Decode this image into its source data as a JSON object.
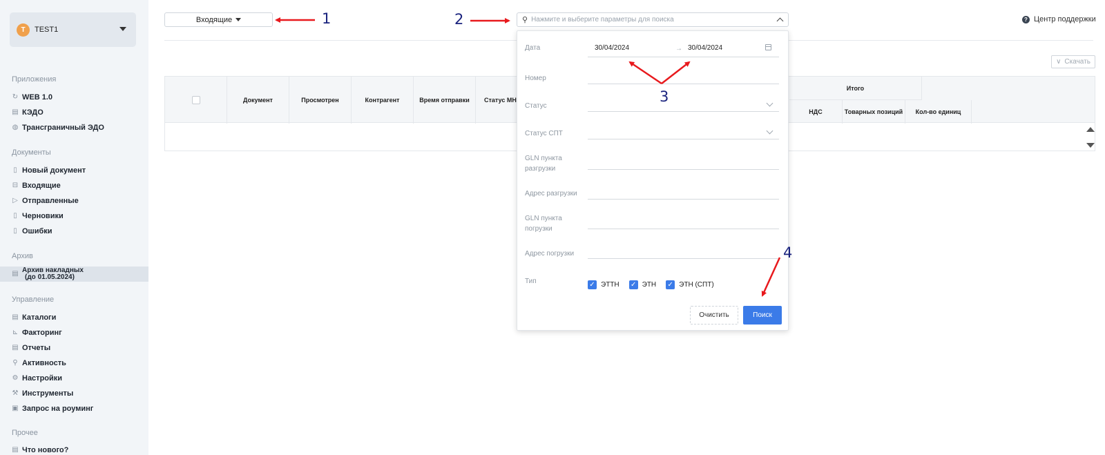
{
  "user": {
    "initial": "T",
    "name": "TEST1"
  },
  "sidebar": {
    "sections": {
      "apps": "Приложения",
      "documents": "Документы",
      "archive": "Архив",
      "management": "Управление",
      "other": "Прочее"
    },
    "apps": [
      {
        "label": "WEB 1.0",
        "icon": "refresh-icon"
      },
      {
        "label": "КЭДО",
        "icon": "document-icon"
      },
      {
        "label": "Трансграничный ЭДО",
        "icon": "globe-icon"
      }
    ],
    "documents": [
      {
        "label": "Новый документ",
        "icon": "new-document-icon"
      },
      {
        "label": "Входящие",
        "icon": "inbox-icon"
      },
      {
        "label": "Отправленные",
        "icon": "send-icon"
      },
      {
        "label": "Черновики",
        "icon": "draft-icon"
      },
      {
        "label": "Ошибки",
        "icon": "error-document-icon"
      }
    ],
    "archive": {
      "line1": "Архив накладных",
      "line2": "(до 01.05.2024)"
    },
    "management": [
      {
        "label": "Каталоги",
        "icon": "catalog-icon"
      },
      {
        "label": "Факторинг",
        "icon": "chart-icon"
      },
      {
        "label": "Отчеты",
        "icon": "report-icon"
      },
      {
        "label": "Активность",
        "icon": "search-icon"
      },
      {
        "label": "Настройки",
        "icon": "gear-icon"
      },
      {
        "label": "Инструменты",
        "icon": "wrench-icon"
      },
      {
        "label": "Запрос на роуминг",
        "icon": "roaming-icon"
      }
    ],
    "other": [
      {
        "label": "Что нового?",
        "icon": "news-icon"
      }
    ]
  },
  "toolbar": {
    "folder_dropdown": "Входящие",
    "search_placeholder": "Нажмите и выберите параметры для поиска",
    "help_label": "Центр поддержки",
    "download_label": "Скачать"
  },
  "table": {
    "columns": [
      "Документ",
      "Просмотрен",
      "Контрагент",
      "Время отправки",
      "Статус МНС"
    ],
    "group_header": "Итого",
    "group_columns": [
      "НДС",
      "Товарных позиций",
      "Кол-во единиц"
    ]
  },
  "search_panel": {
    "labels": {
      "date": "Дата",
      "number": "Номер",
      "status": "Статус",
      "status_spt": "Статус СПТ",
      "gln_unload_1": "GLN пункта",
      "gln_unload_2": "разгрузки",
      "address_unload": "Адрес разгрузки",
      "gln_load_1": "GLN пункта",
      "gln_load_2": "погрузки",
      "address_load": "Адрес погрузки",
      "type": "Тип"
    },
    "date_from": "30/04/2024",
    "date_to": "30/04/2024",
    "types": [
      "ЭТТН",
      "ЭТН",
      "ЭТН (СПТ)"
    ],
    "clear_label": "Очистить",
    "search_label": "Поиск"
  },
  "annotations": [
    "1",
    "2",
    "3",
    "4"
  ],
  "colors": {
    "accent": "#3b7be8",
    "annotation_arrow": "#e8191d",
    "annotation_number": "#1a237e"
  }
}
